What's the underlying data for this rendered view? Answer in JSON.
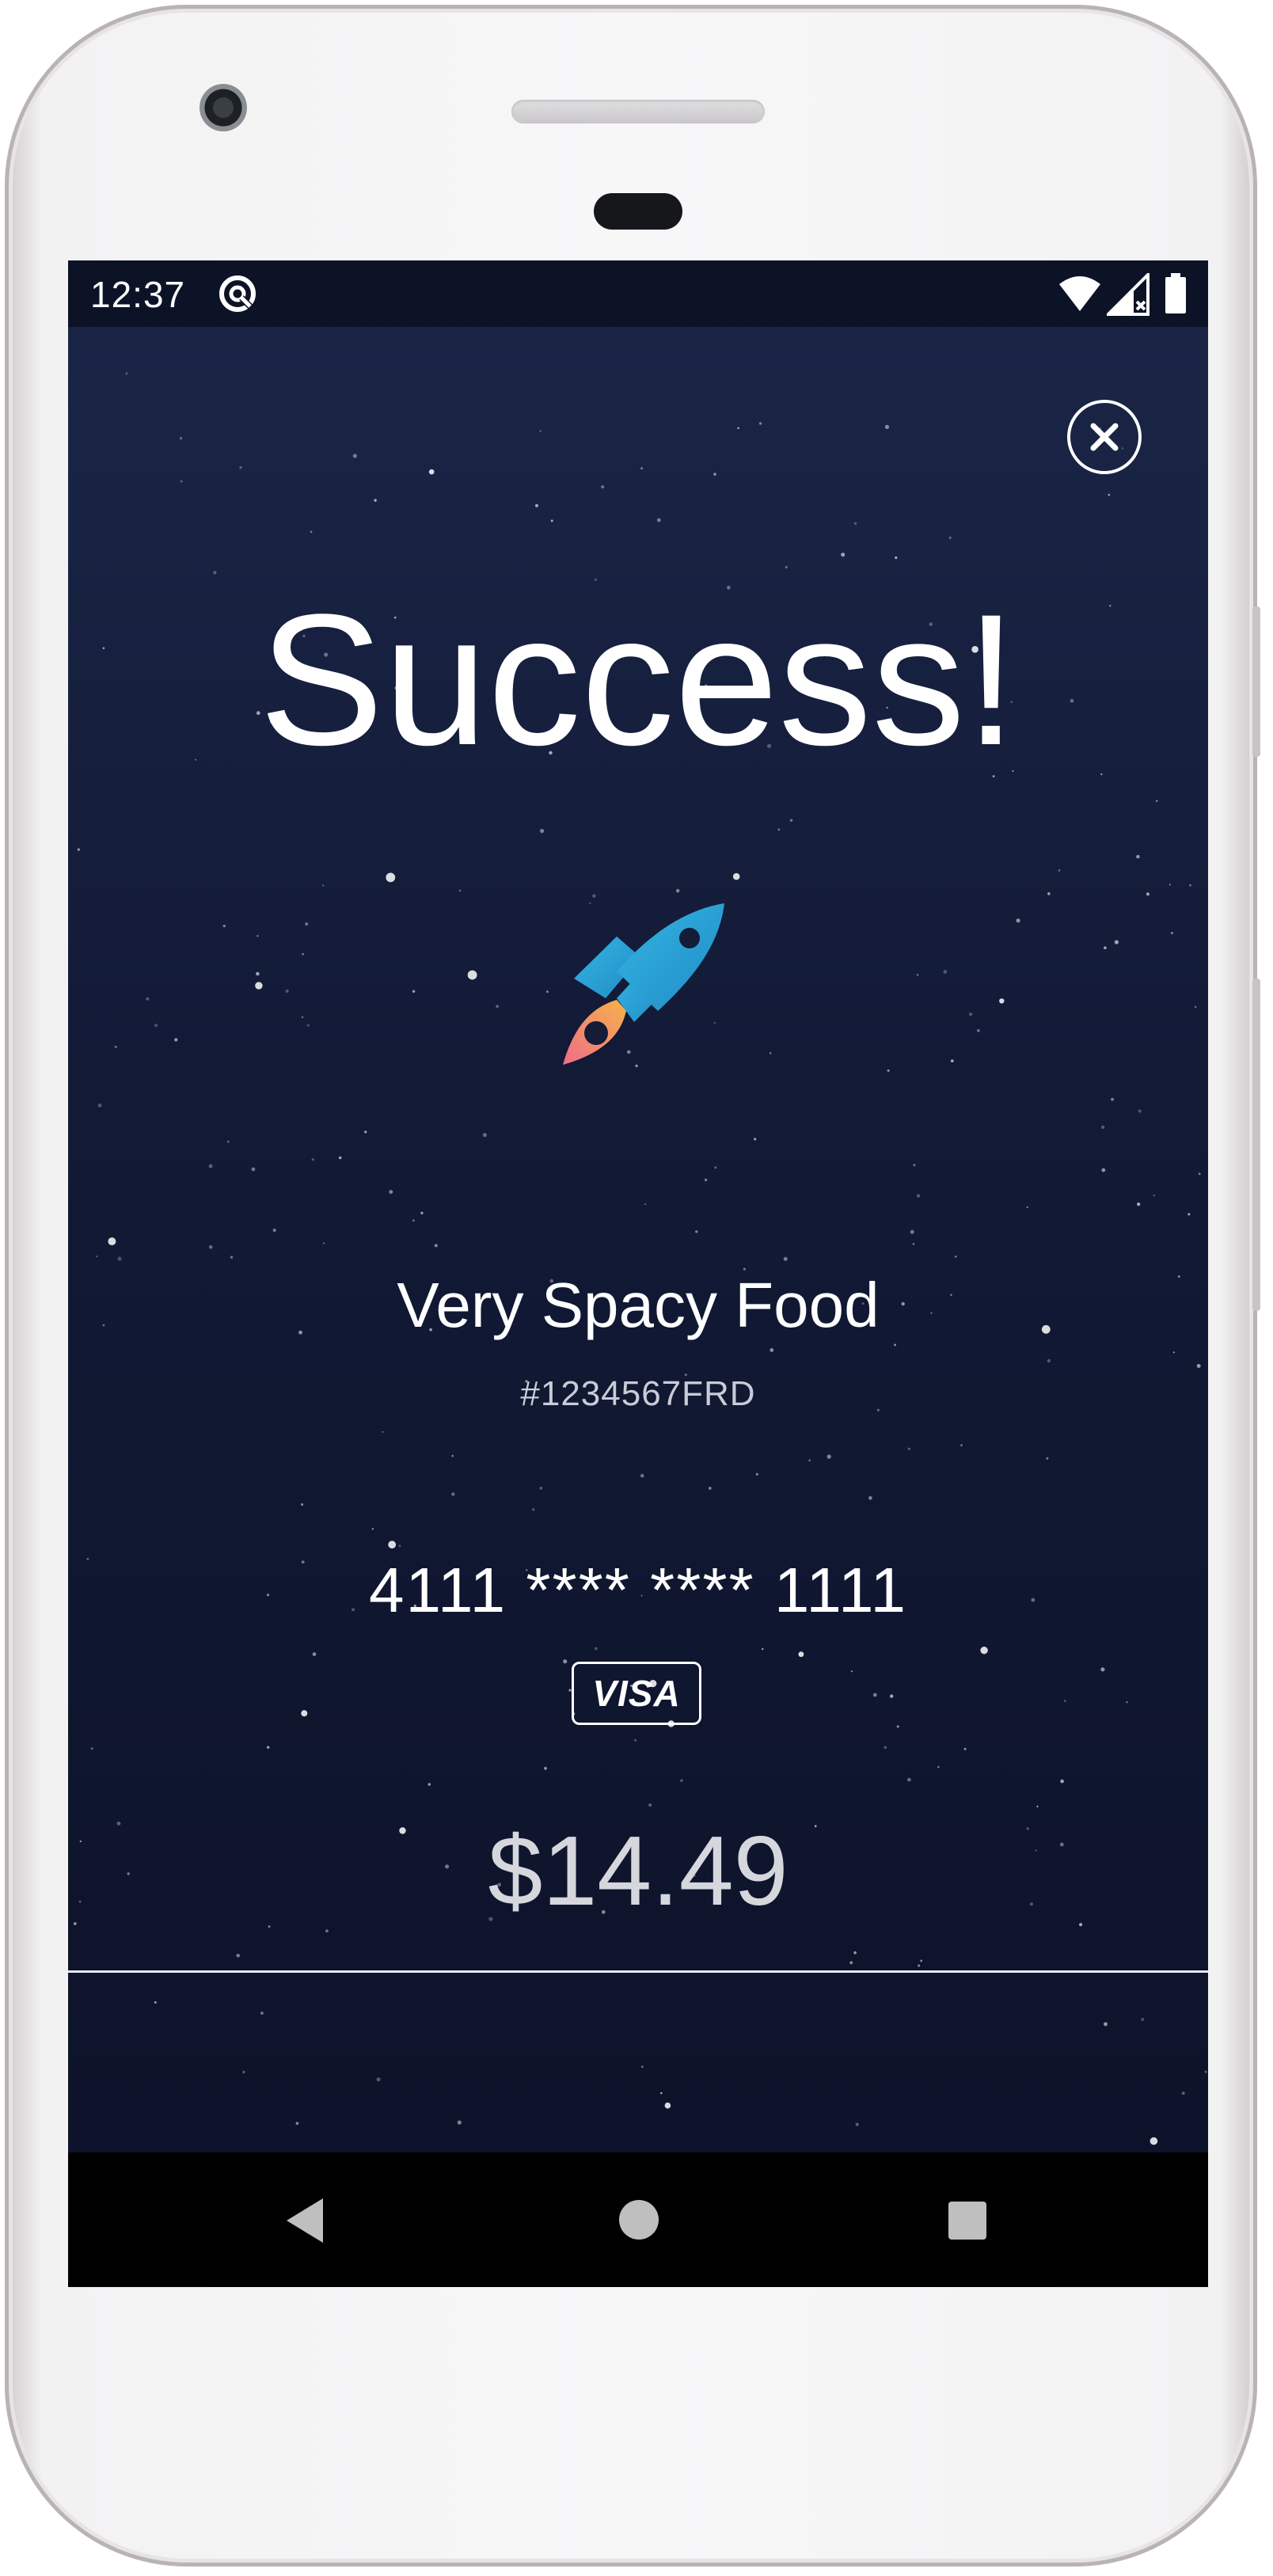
{
  "status_bar": {
    "time": "12:37",
    "app_icon": "notification-app-icon",
    "wifi_icon": "wifi-icon",
    "signal_icon": "cell-signal-icon",
    "battery_icon": "battery-icon"
  },
  "header": {
    "close_icon": "close-icon"
  },
  "result": {
    "headline": "Success!",
    "icon": "rocket-icon",
    "merchant_name": "Very Spacy Food",
    "order_number": "#1234567FRD",
    "card_number": "4111 **** **** 1111",
    "card_brand": "VISA",
    "amount": "$14.49"
  },
  "nav_bar": {
    "back_icon": "back-icon",
    "home_icon": "home-icon",
    "recents_icon": "recents-icon"
  },
  "colors": {
    "background_top": "#1b2648",
    "background_bottom": "#0c1228",
    "rocket_body": "#2a9ed4",
    "rocket_flame_start": "#f6b24a",
    "rocket_flame_end": "#ee6d88",
    "text_primary": "#ffffff"
  }
}
